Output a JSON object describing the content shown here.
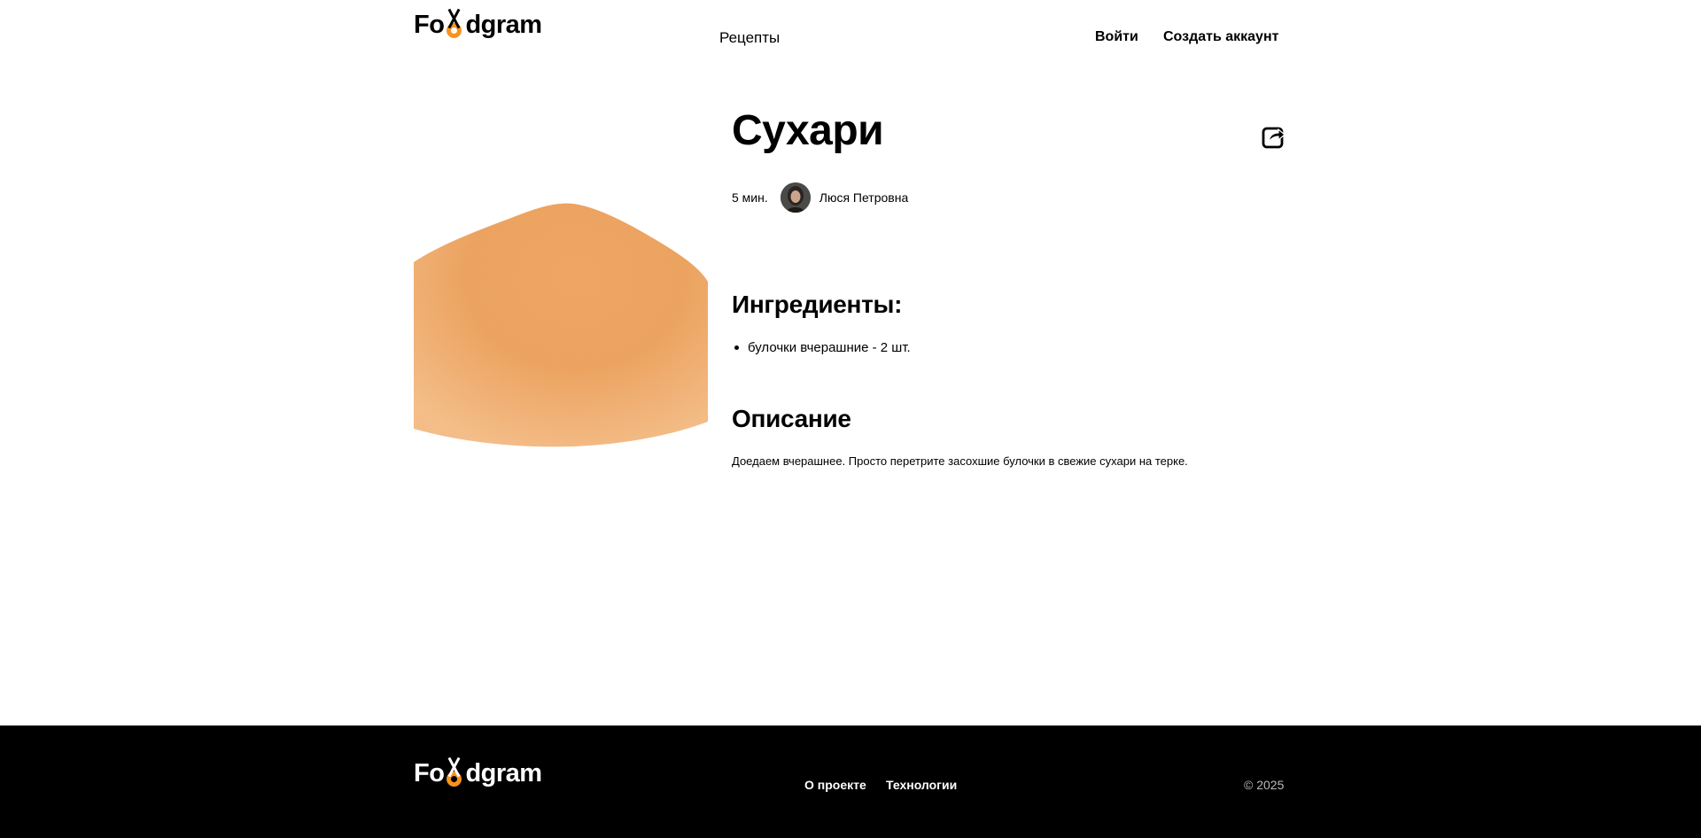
{
  "header": {
    "logo": {
      "prefix": "Fo",
      "suffix": "dgram"
    },
    "nav_recipes": "Рецепты",
    "login": "Войти",
    "signup": "Создать аккаунт"
  },
  "recipe": {
    "title": "Сухари",
    "time": "5 мин.",
    "author": "Люся Петровна",
    "ingredients_heading": "Ингредиенты:",
    "ingredients": [
      "булочки вчерашние - 2 шт."
    ],
    "description_heading": "Описание",
    "description": "Доедаем вчерашнее. Просто перетрите засохшие булочки в свежие сухари на терке."
  },
  "footer": {
    "logo": {
      "prefix": "Fo",
      "suffix": "dgram"
    },
    "about": "О проекте",
    "technologies": "Технологии",
    "copyright": "© 2025"
  },
  "colors": {
    "accent": "#f7931e",
    "footer_bg": "#000000"
  }
}
